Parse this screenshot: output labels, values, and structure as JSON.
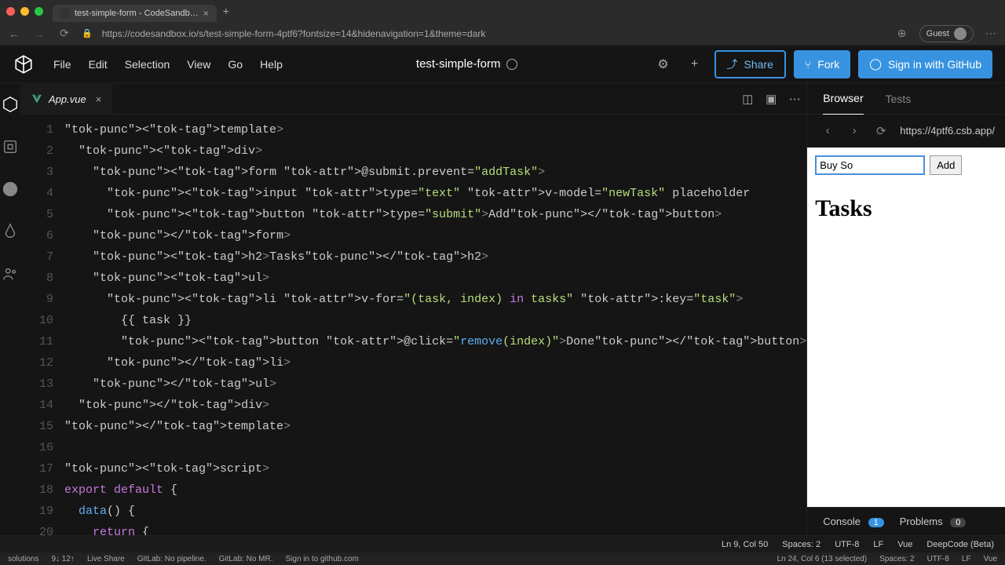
{
  "mac": {
    "tab_title": "test-simple-form - CodeSandb…"
  },
  "chrome": {
    "url": "https://codesandbox.io/s/test-simple-form-4ptf6?fontsize=14&hidenavigation=1&theme=dark",
    "guest_label": "Guest"
  },
  "menu": {
    "file": "File",
    "edit": "Edit",
    "selection": "Selection",
    "view": "View",
    "go": "Go",
    "help": "Help"
  },
  "project": {
    "title": "test-simple-form"
  },
  "buttons": {
    "share": "Share",
    "fork": "Fork",
    "github": "Sign in with GitHub"
  },
  "file_tab": {
    "name": "App.vue"
  },
  "code_lines": [
    "<template>",
    "  <div>",
    "    <form @submit.prevent=\"addTask\">",
    "      <input type=\"text\" v-model=\"newTask\" placeholder",
    "      <button type=\"submit\">Add</button>",
    "    </form>",
    "    <h2>Tasks</h2>",
    "    <ul>",
    "      <li v-for=\"(task, index) in tasks\" :key=\"task\">",
    "        {{ task }}",
    "        <button @click=\"remove(index)\">Done</button>",
    "      </li>",
    "    </ul>",
    "  </div>",
    "</template>",
    "",
    "<script>",
    "export default {",
    "  data() {",
    "    return {"
  ],
  "preview": {
    "tab_browser": "Browser",
    "tab_tests": "Tests",
    "url": "https://4ptf6.csb.app/",
    "input_value": "Buy So",
    "add_label": "Add",
    "heading": "Tasks"
  },
  "console": {
    "console_label": "Console",
    "console_count": "1",
    "problems_label": "Problems",
    "problems_count": "0"
  },
  "status": {
    "cursor": "Ln 9, Col 50",
    "spaces": "Spaces: 2",
    "encoding": "UTF-8",
    "eol": "LF",
    "lang": "Vue",
    "deepcode": "DeepCode (Beta)"
  },
  "bottom": {
    "solutions": "solutions",
    "commits": "9↓ 12↑",
    "liveshare": "Live Share",
    "gitlab": "GitLab: No pipeline.",
    "gitlab_mr": "GitLab: No MR.",
    "signin": "Sign in to github.com",
    "selection": "Ln 24, Col 6 (13 selected)",
    "spaces": "Spaces: 2",
    "encoding": "UTF-8",
    "eol": "LF",
    "lang": "Vue"
  }
}
